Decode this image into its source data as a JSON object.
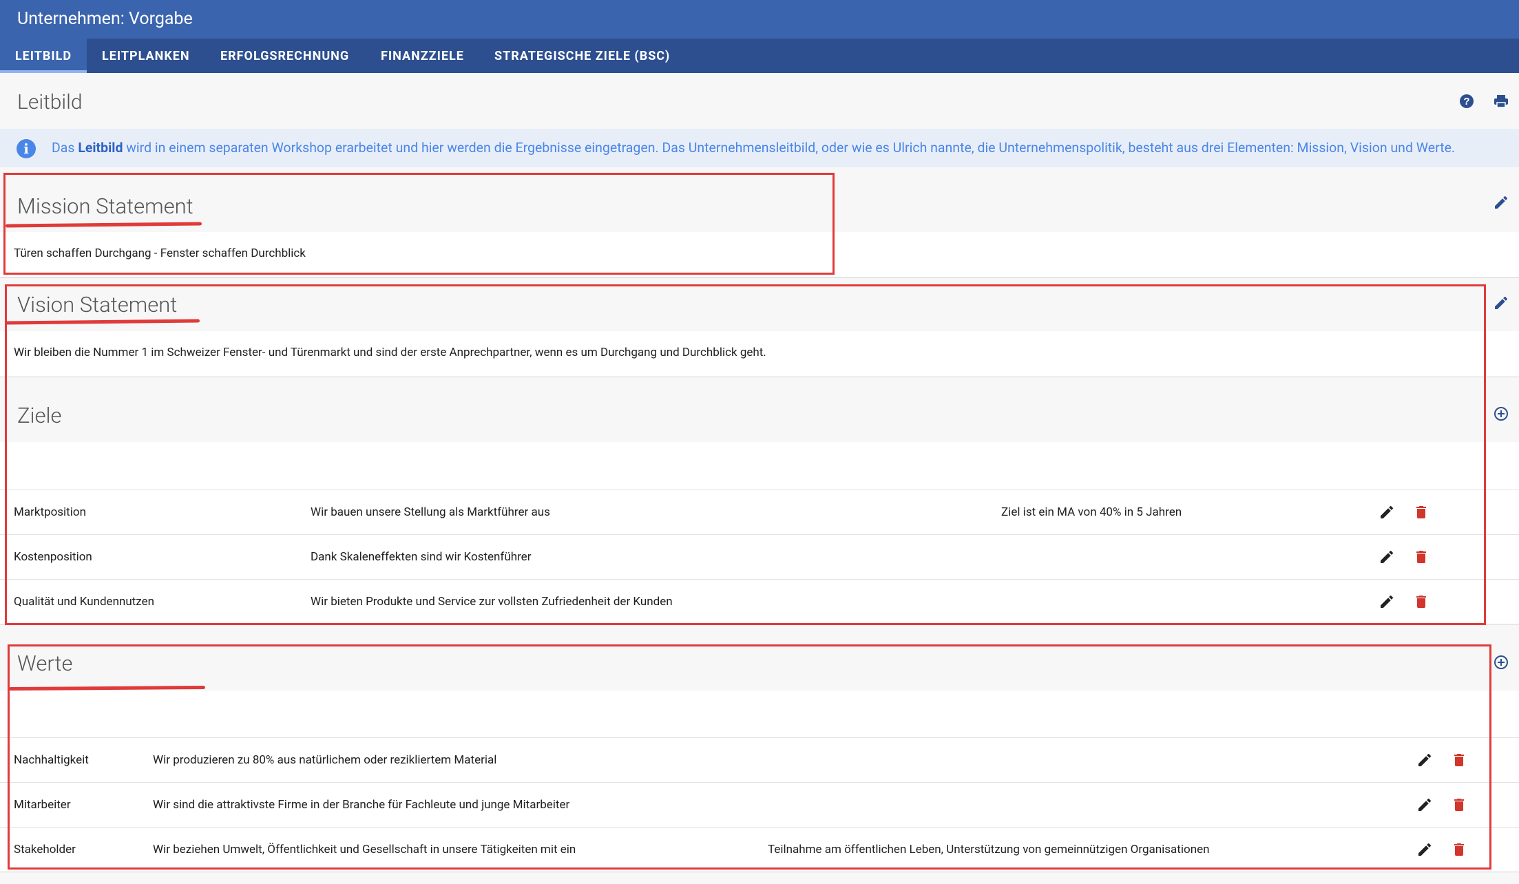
{
  "app": {
    "title": "Unternehmen: Vorgabe"
  },
  "tabs": [
    {
      "label": "LEITBILD",
      "active": true
    },
    {
      "label": "LEITPLANKEN"
    },
    {
      "label": "ERFOLGSRECHNUNG"
    },
    {
      "label": "FINANZZIELE"
    },
    {
      "label": "STRATEGISCHE ZIELE (BSC)"
    }
  ],
  "page": {
    "title": "Leitbild"
  },
  "info": {
    "prefix": "Das ",
    "bold": "Leitbild",
    "suffix": " wird in einem separaten Workshop erarbeitet und hier werden die Ergebnisse eingetragen. Das Unternehmensleitbild, oder wie es Ulrich nannte, die Unternehmenspolitik, besteht aus drei Elementen: Mission, Vision und Werte."
  },
  "mission": {
    "title": "Mission Statement",
    "text": "Türen schaffen Durchgang - Fenster schaffen Durchblick"
  },
  "vision": {
    "title": "Vision Statement",
    "text": "Wir bleiben die Nummer 1 im Schweizer Fenster- und Türenmarkt und sind der erste Anprechpartner, wenn es um Durchgang und Durchblick geht."
  },
  "ziele": {
    "title": "Ziele",
    "rows": [
      {
        "name": "Marktposition",
        "desc": "Wir bauen unsere Stellung als Marktführer aus",
        "note": "Ziel ist ein MA von 40% in 5 Jahren"
      },
      {
        "name": "Kostenposition",
        "desc": "Dank Skaleneffekten sind wir Kostenführer",
        "note": ""
      },
      {
        "name": "Qualität und Kundennutzen",
        "desc": "Wir bieten Produkte und Service zur vollsten Zufriedenheit der Kunden",
        "note": ""
      }
    ]
  },
  "werte": {
    "title": "Werte",
    "rows": [
      {
        "name": "Nachhaltigkeit",
        "desc": "Wir produzieren zu 80% aus natürlichem oder rezikliertem Material",
        "note": ""
      },
      {
        "name": "Mitarbeiter",
        "desc": "Wir sind die attraktivste Firme in der Branche für Fachleute und junge Mitarbeiter",
        "note": ""
      },
      {
        "name": "Stakeholder",
        "desc": "Wir beziehen Umwelt, Öffentlichkeit und Gesellschaft in unsere Tätigkeiten mit ein",
        "note": "Teilnahme am öffentlichen Leben, Unterstützung von gemeinnützigen Organisationen"
      }
    ]
  },
  "colors": {
    "primary": "#3a64ad",
    "tabbar": "#2d4f8f",
    "delete": "#d0362c",
    "annotation": "#e03a3a"
  }
}
